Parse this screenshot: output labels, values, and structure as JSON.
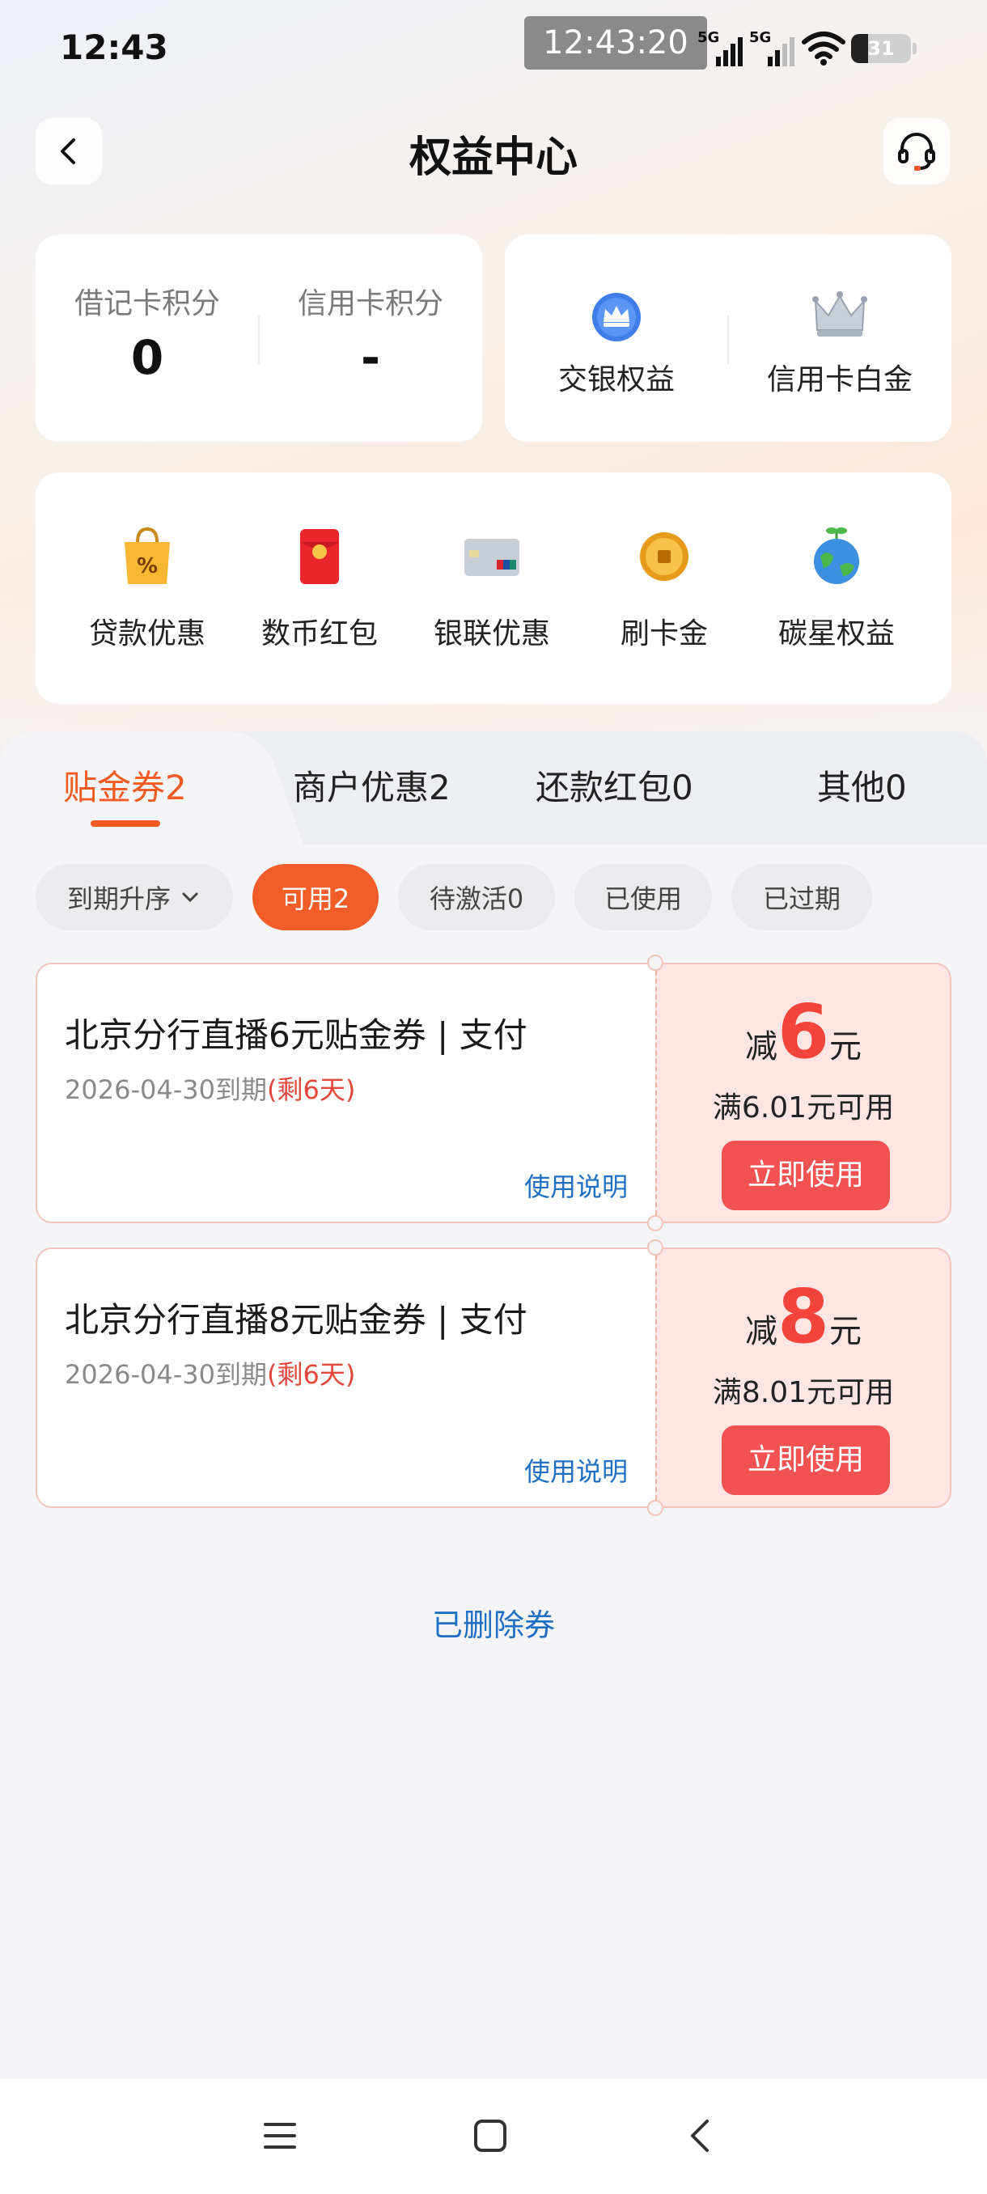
{
  "status_bar": {
    "time": "12:43",
    "overlay_time": "12:43:20",
    "network_1": "5G",
    "network_2": "5G",
    "battery": "31"
  },
  "header": {
    "title": "权益中心",
    "back_icon": "chevron-left-icon",
    "service_icon": "headset-icon"
  },
  "points": [
    {
      "label": "借记卡积分",
      "value": "0"
    },
    {
      "label": "信用卡积分",
      "value": "-"
    }
  ],
  "rights": [
    {
      "label": "交银权益",
      "icon": "blue-crown-badge-icon"
    },
    {
      "label": "信用卡白金",
      "icon": "silver-crown-icon"
    }
  ],
  "quick_entries": [
    {
      "label": "贷款优惠",
      "icon": "shopping-bag-percent-icon"
    },
    {
      "label": "数币红包",
      "icon": "red-envelope-icon"
    },
    {
      "label": "银联优惠",
      "icon": "unionpay-card-icon"
    },
    {
      "label": "刷卡金",
      "icon": "gold-coin-icon"
    },
    {
      "label": "碳星权益",
      "icon": "earth-plant-icon"
    }
  ],
  "tabs": [
    {
      "label": "贴金券2",
      "active": true
    },
    {
      "label": "商户优惠2",
      "active": false
    },
    {
      "label": "还款红包0",
      "active": false
    },
    {
      "label": "其他0",
      "active": false
    }
  ],
  "filters": {
    "sort": "到期升序",
    "chips": [
      {
        "label": "可用2",
        "active": true
      },
      {
        "label": "待激活0",
        "active": false
      },
      {
        "label": "已使用",
        "active": false
      },
      {
        "label": "已过期",
        "active": false
      }
    ]
  },
  "coupons": [
    {
      "title": "北京分行直播6元贴金券 | 支付",
      "expire": "2026-04-30到期",
      "remain": "(剩6天)",
      "help": "使用说明",
      "prefix": "减",
      "amount": "6",
      "suffix": "元",
      "condition": "满6.01元可用",
      "button": "立即使用"
    },
    {
      "title": "北京分行直播8元贴金券 | 支付",
      "expire": "2026-04-30到期",
      "remain": "(剩6天)",
      "help": "使用说明",
      "prefix": "减",
      "amount": "8",
      "suffix": "元",
      "condition": "满8.01元可用",
      "button": "立即使用"
    }
  ],
  "deleted_link": "已删除券",
  "colors": {
    "accent": "#f05a23",
    "coupon_red": "#f2443a",
    "link_blue": "#1f6fc4",
    "coupon_bg": "#fde5e3"
  }
}
